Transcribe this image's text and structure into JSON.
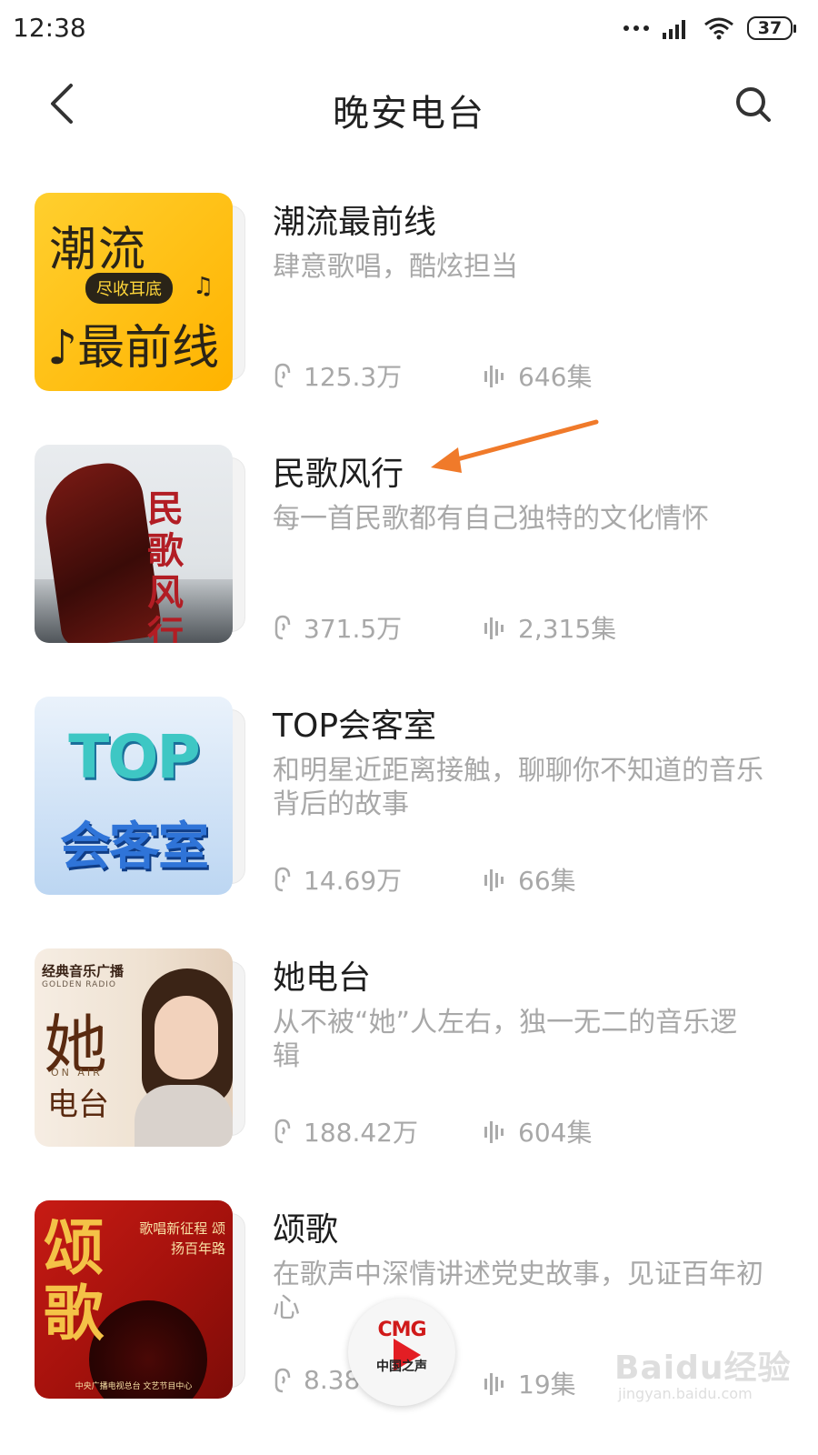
{
  "status": {
    "time": "12:38",
    "battery": "37"
  },
  "header": {
    "title": "晚安电台"
  },
  "items": [
    {
      "title": "潮流最前线",
      "desc": "肆意歌唱，酷炫担当",
      "plays": "125.3万",
      "episodes": "646集",
      "cover": {
        "line1": "潮流",
        "pill": "尽收耳底",
        "line2": "♪最前线",
        "note": "♫"
      }
    },
    {
      "title": "民歌风行",
      "desc": "每一首民歌都有自己独特的文化情怀",
      "plays": "371.5万",
      "episodes": "2,315集",
      "cover": {
        "text": "民歌风行"
      }
    },
    {
      "title": "TOP会客室",
      "desc": "和明星近距离接触，聊聊你不知道的音乐背后的故事",
      "plays": "14.69万",
      "episodes": "66集",
      "cover": {
        "line1": "TOP",
        "line2": "会客室"
      }
    },
    {
      "title": "她电台",
      "desc": "从不被“她”人左右，独一无二的音乐逻辑",
      "plays": "188.42万",
      "episodes": "604集",
      "cover": {
        "logo": "经典音乐广播",
        "logo_en": "GOLDEN RADIO",
        "big": "她",
        "onair": "ON AIR",
        "small": "电台"
      }
    },
    {
      "title": "颂歌",
      "desc": "在歌声中深情讲述党史故事，见证百年初心",
      "plays": "8.38",
      "episodes": "19集",
      "cover": {
        "big": "颂歌",
        "lines": "歌唱新征程 颂扬百年路",
        "foot": "中央广播电视总台 文艺节目中心"
      }
    }
  ],
  "mini_player": {
    "logo": "CMG",
    "sub": "中国之声"
  },
  "watermark": {
    "main": "Baidu经验",
    "sub": "jingyan.baidu.com"
  },
  "colors": {
    "accent_arrow": "#f07a2a",
    "title_text": "#1e1e1e",
    "muted_text": "#a8a8a8"
  }
}
